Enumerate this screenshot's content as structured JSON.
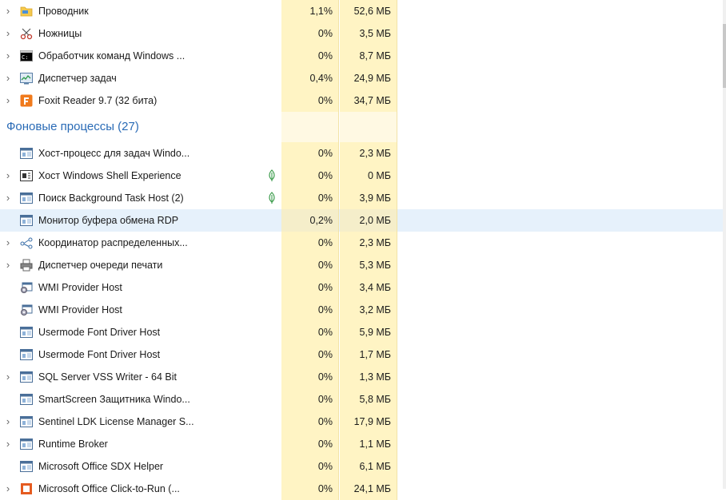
{
  "apps": [
    {
      "name": "Проводник",
      "cpu": "1,1%",
      "mem": "52,6 МБ",
      "icon": "folder-icon",
      "expandable": true
    },
    {
      "name": "Ножницы",
      "cpu": "0%",
      "mem": "3,5 МБ",
      "icon": "scissors-icon",
      "expandable": true
    },
    {
      "name": "Обработчик команд Windows ...",
      "cpu": "0%",
      "mem": "8,7 МБ",
      "icon": "cmd-icon",
      "expandable": true
    },
    {
      "name": "Диспетчер задач",
      "cpu": "0,4%",
      "mem": "24,9 МБ",
      "icon": "task-manager-icon",
      "expandable": true
    },
    {
      "name": "Foxit Reader 9.7 (32 бита)",
      "cpu": "0%",
      "mem": "34,7 МБ",
      "icon": "foxit-icon",
      "expandable": true
    }
  ],
  "group": {
    "title": "Фоновые процессы (27)"
  },
  "background": [
    {
      "name": "Хост-процесс для задач Windo...",
      "cpu": "0%",
      "mem": "2,3 МБ",
      "icon": "window-icon",
      "expandable": false
    },
    {
      "name": "Хост Windows Shell Experience",
      "cpu": "0%",
      "mem": "0 МБ",
      "icon": "shell-icon",
      "expandable": true,
      "leaf": true
    },
    {
      "name": "Поиск Background Task Host (2)",
      "cpu": "0%",
      "mem": "3,9 МБ",
      "icon": "window-icon",
      "expandable": true,
      "leaf": true
    },
    {
      "name": "Монитор буфера обмена RDP",
      "cpu": "0,2%",
      "mem": "2,0 МБ",
      "icon": "window-icon",
      "expandable": false,
      "selected": true
    },
    {
      "name": "Координатор распределенных...",
      "cpu": "0%",
      "mem": "2,3 МБ",
      "icon": "network-icon",
      "expandable": true
    },
    {
      "name": "Диспетчер очереди печати",
      "cpu": "0%",
      "mem": "5,3 МБ",
      "icon": "printer-icon",
      "expandable": true
    },
    {
      "name": "WMI Provider Host",
      "cpu": "0%",
      "mem": "3,4 МБ",
      "icon": "wmi-icon",
      "expandable": false
    },
    {
      "name": "WMI Provider Host",
      "cpu": "0%",
      "mem": "3,2 МБ",
      "icon": "wmi-icon",
      "expandable": false
    },
    {
      "name": "Usermode Font Driver Host",
      "cpu": "0%",
      "mem": "5,9 МБ",
      "icon": "window-icon",
      "expandable": false
    },
    {
      "name": "Usermode Font Driver Host",
      "cpu": "0%",
      "mem": "1,7 МБ",
      "icon": "window-icon",
      "expandable": false
    },
    {
      "name": "SQL Server VSS Writer - 64 Bit",
      "cpu": "0%",
      "mem": "1,3 МБ",
      "icon": "window-icon",
      "expandable": true
    },
    {
      "name": "SmartScreen Защитника Windo...",
      "cpu": "0%",
      "mem": "5,8 МБ",
      "icon": "window-icon",
      "expandable": false
    },
    {
      "name": "Sentinel LDK License Manager S...",
      "cpu": "0%",
      "mem": "17,9 МБ",
      "icon": "window-icon",
      "expandable": true
    },
    {
      "name": "Runtime Broker",
      "cpu": "0%",
      "mem": "1,1 МБ",
      "icon": "window-icon",
      "expandable": true
    },
    {
      "name": "Microsoft Office SDX Helper",
      "cpu": "0%",
      "mem": "6,1 МБ",
      "icon": "window-icon",
      "expandable": false
    },
    {
      "name": "Microsoft Office Click-to-Run (...",
      "cpu": "0%",
      "mem": "24,1 МБ",
      "icon": "office-icon",
      "expandable": true
    }
  ],
  "colors": {
    "accent": "#2a6bb6",
    "cell": "#fff4c4",
    "selected": "#e6f1fb",
    "leaf": "#3a9a4a"
  }
}
